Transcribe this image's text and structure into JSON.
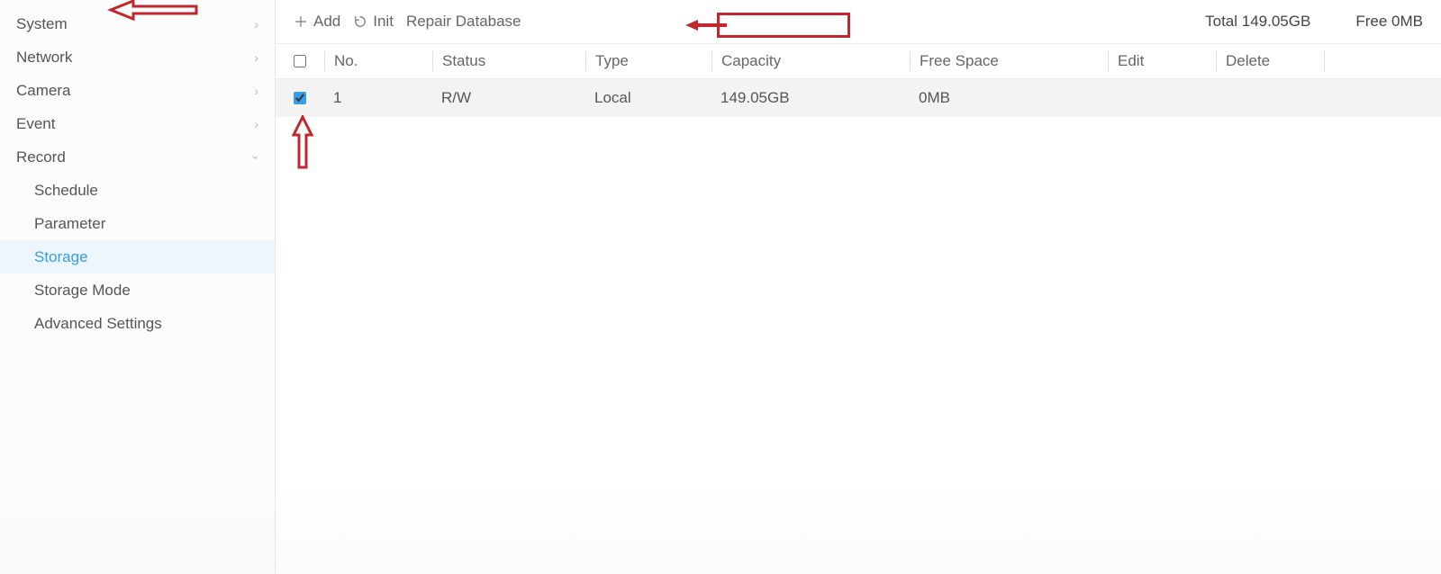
{
  "sidebar": {
    "items": [
      {
        "label": "System",
        "expanded": false,
        "hasChildren": true
      },
      {
        "label": "Network",
        "expanded": false,
        "hasChildren": true
      },
      {
        "label": "Camera",
        "expanded": false,
        "hasChildren": true
      },
      {
        "label": "Event",
        "expanded": false,
        "hasChildren": true
      },
      {
        "label": "Record",
        "expanded": true,
        "hasChildren": true,
        "children": [
          {
            "label": "Schedule",
            "active": false
          },
          {
            "label": "Parameter",
            "active": false
          },
          {
            "label": "Storage",
            "active": true
          },
          {
            "label": "Storage Mode",
            "active": false
          },
          {
            "label": "Advanced Settings",
            "active": false
          }
        ]
      }
    ]
  },
  "toolbar": {
    "add_label": "Add",
    "init_label": "Init",
    "repair_label": "Repair Database",
    "status_total_label": "Total",
    "status_total_value": "149.05GB",
    "status_free_label": "Free",
    "status_free_value": "0MB"
  },
  "table": {
    "headers": {
      "no": "No.",
      "status": "Status",
      "type": "Type",
      "capacity": "Capacity",
      "free_space": "Free Space",
      "edit": "Edit",
      "delete": "Delete"
    },
    "rows": [
      {
        "checked": true,
        "no": "1",
        "status": "R/W",
        "type": "Local",
        "capacity": "149.05GB",
        "free_space": "0MB"
      }
    ]
  }
}
